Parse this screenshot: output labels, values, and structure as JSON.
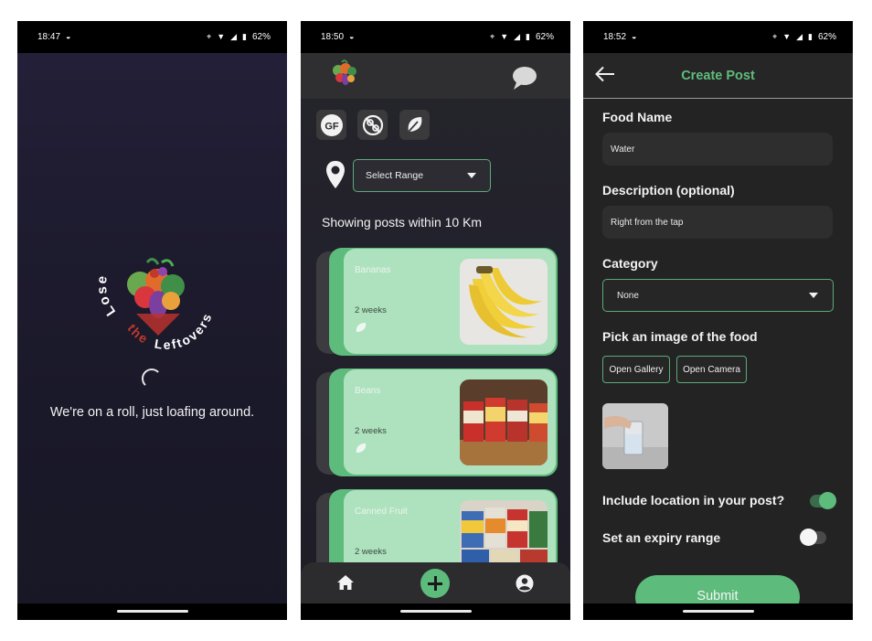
{
  "screens": {
    "splash": {
      "status": {
        "time": "18:47",
        "battery": "62%"
      },
      "logo": {
        "word1": "Lose",
        "word2": "the",
        "word3": "Leftovers"
      },
      "message": "We're on a roll, just loafing around."
    },
    "feed": {
      "status": {
        "time": "18:50",
        "battery": "62%"
      },
      "filters": {
        "gluten_free_label": "GF"
      },
      "range_select": {
        "value": "Select Range"
      },
      "showing_text": "Showing posts within 10 Km",
      "posts": [
        {
          "name": "Bananas",
          "time": "2 weeks"
        },
        {
          "name": "Beans",
          "time": "2 weeks"
        },
        {
          "name": "Canned Fruit",
          "time": "2 weeks"
        }
      ],
      "nav": {
        "home": "home-icon",
        "add": "add-icon",
        "profile": "profile-icon"
      }
    },
    "create": {
      "status": {
        "time": "18:52",
        "battery": "62%"
      },
      "title": "Create Post",
      "food_name": {
        "label": "Food Name",
        "value": "Water"
      },
      "description": {
        "label": "Description (optional)",
        "value": "Right from the tap"
      },
      "category": {
        "label": "Category",
        "value": "None"
      },
      "image": {
        "label": "Pick an image of the food",
        "gallery": "Open Gallery",
        "camera": "Open Camera"
      },
      "include_location": {
        "label": "Include location in your post?",
        "on": true
      },
      "expiry": {
        "label": "Set an expiry range",
        "on": false
      },
      "submit": "Submit"
    }
  },
  "colors": {
    "accent": "#5dbb7c",
    "card": "#aee2be",
    "dark": "#232323"
  }
}
